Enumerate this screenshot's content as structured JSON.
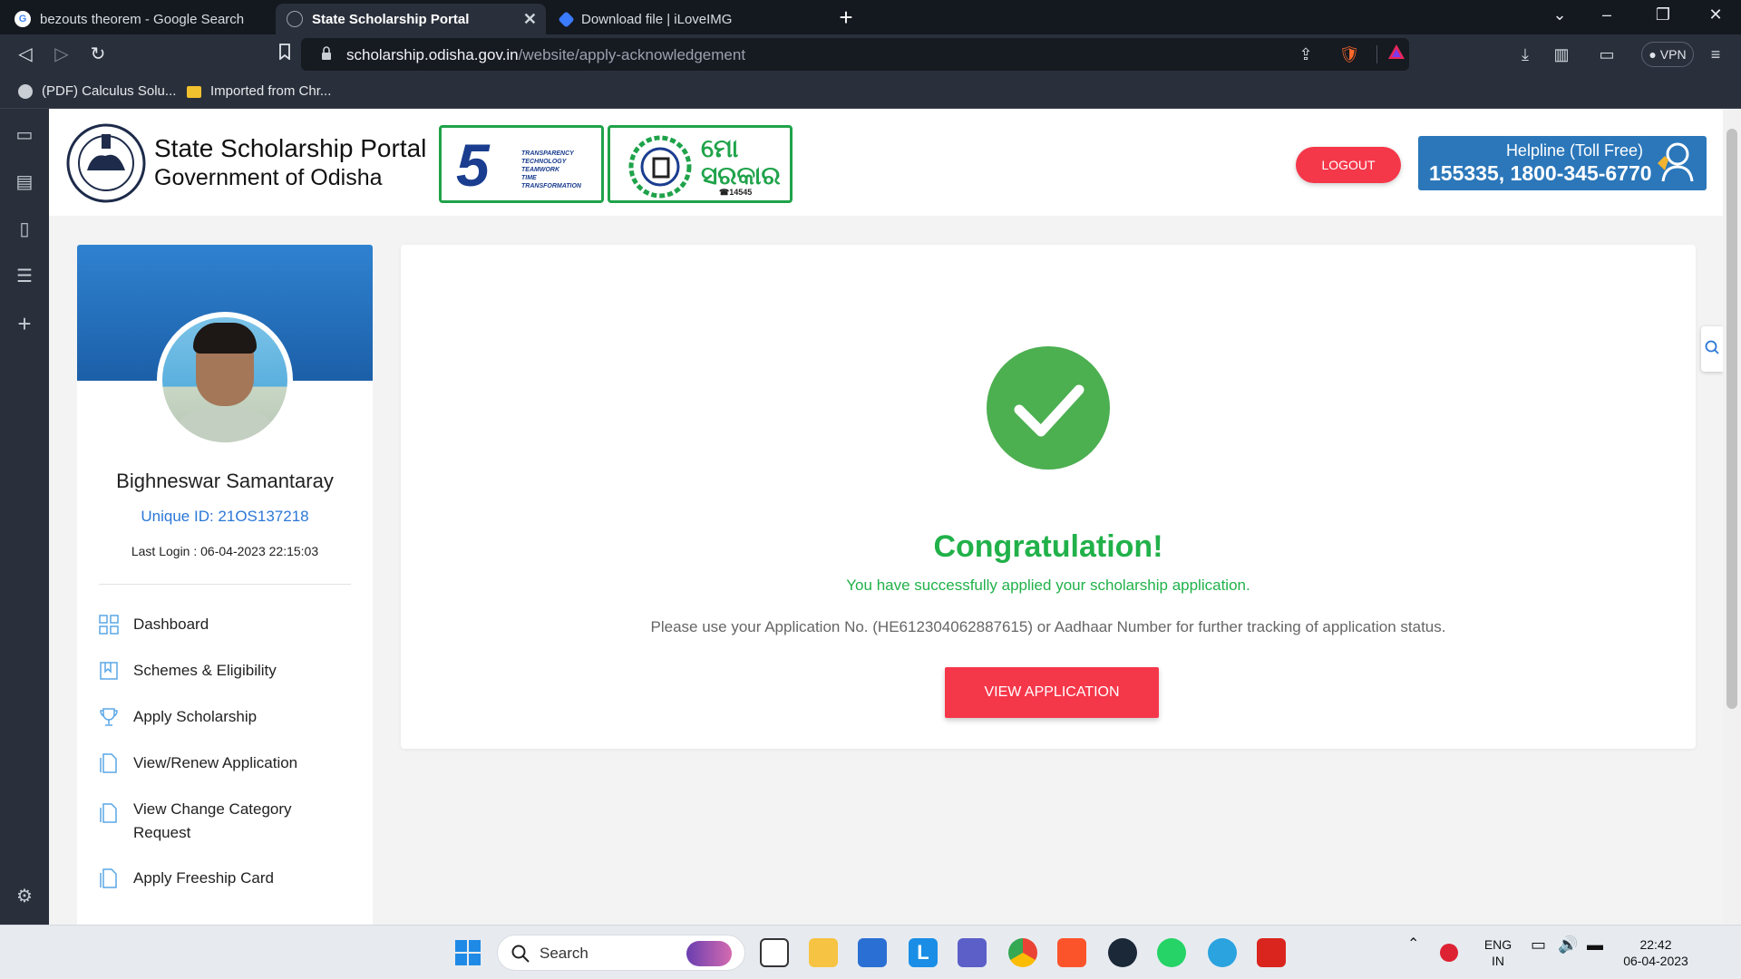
{
  "browser": {
    "tabs": [
      {
        "title": "bezouts theorem - Google Search",
        "active": false
      },
      {
        "title": "State Scholarship Portal",
        "active": true
      },
      {
        "title": "Download file | iLoveIMG",
        "active": false
      }
    ],
    "url_domain": "scholarship.odisha.gov.in",
    "url_path": "/website/apply-acknowledgement",
    "vpn_label": "VPN",
    "bookmarks": [
      {
        "label": "(PDF) Calculus Solu..."
      },
      {
        "label": "Imported from Chr..."
      }
    ]
  },
  "header": {
    "title": "State Scholarship Portal",
    "subtitle": "Government of Odisha",
    "logout_label": "LOGOUT",
    "helpline_title": "Helpline (Toll Free)",
    "helpline_numbers": "155335, 1800-345-6770",
    "logo5t_lines": [
      "TRANSPARENCY",
      "TECHNOLOGY",
      "TEAMWORK",
      "TIME",
      "TRANSFORMATION"
    ],
    "logomo_text": [
      "ମୋ",
      "ସରକାର"
    ],
    "logomo_number": "☎14545"
  },
  "profile": {
    "name": "Bighneswar Samantaray",
    "unique_id": "Unique ID: 21OS137218",
    "last_login": "Last Login : 06-04-2023 22:15:03",
    "menu": [
      {
        "label": "Dashboard",
        "icon": "grid-icon"
      },
      {
        "label": "Schemes & Eligibility",
        "icon": "bookmark-icon"
      },
      {
        "label": "Apply Scholarship",
        "icon": "trophy-icon"
      },
      {
        "label": "View/Renew Application",
        "icon": "document-icon"
      },
      {
        "label": "View Change Category Request",
        "icon": "document-icon"
      },
      {
        "label": "Apply Freeship Card",
        "icon": "document-icon"
      }
    ]
  },
  "acknowledgement": {
    "heading": "Congratulation!",
    "success_message": "You have successfully applied your scholarship application.",
    "tracking_message": "Please use your Application No. (HE612304062887615) or Aadhaar Number for further tracking of application status.",
    "button_label": "VIEW APPLICATION"
  },
  "taskbar": {
    "search_label": "Search",
    "lang_top": "ENG",
    "lang_bottom": "IN",
    "time": "22:42",
    "date": "06-04-2023"
  },
  "colors": {
    "accent_red": "#f5374a",
    "success_green": "#21b14a",
    "helpline_blue": "#2b77ba",
    "link_blue": "#2b77d6"
  }
}
